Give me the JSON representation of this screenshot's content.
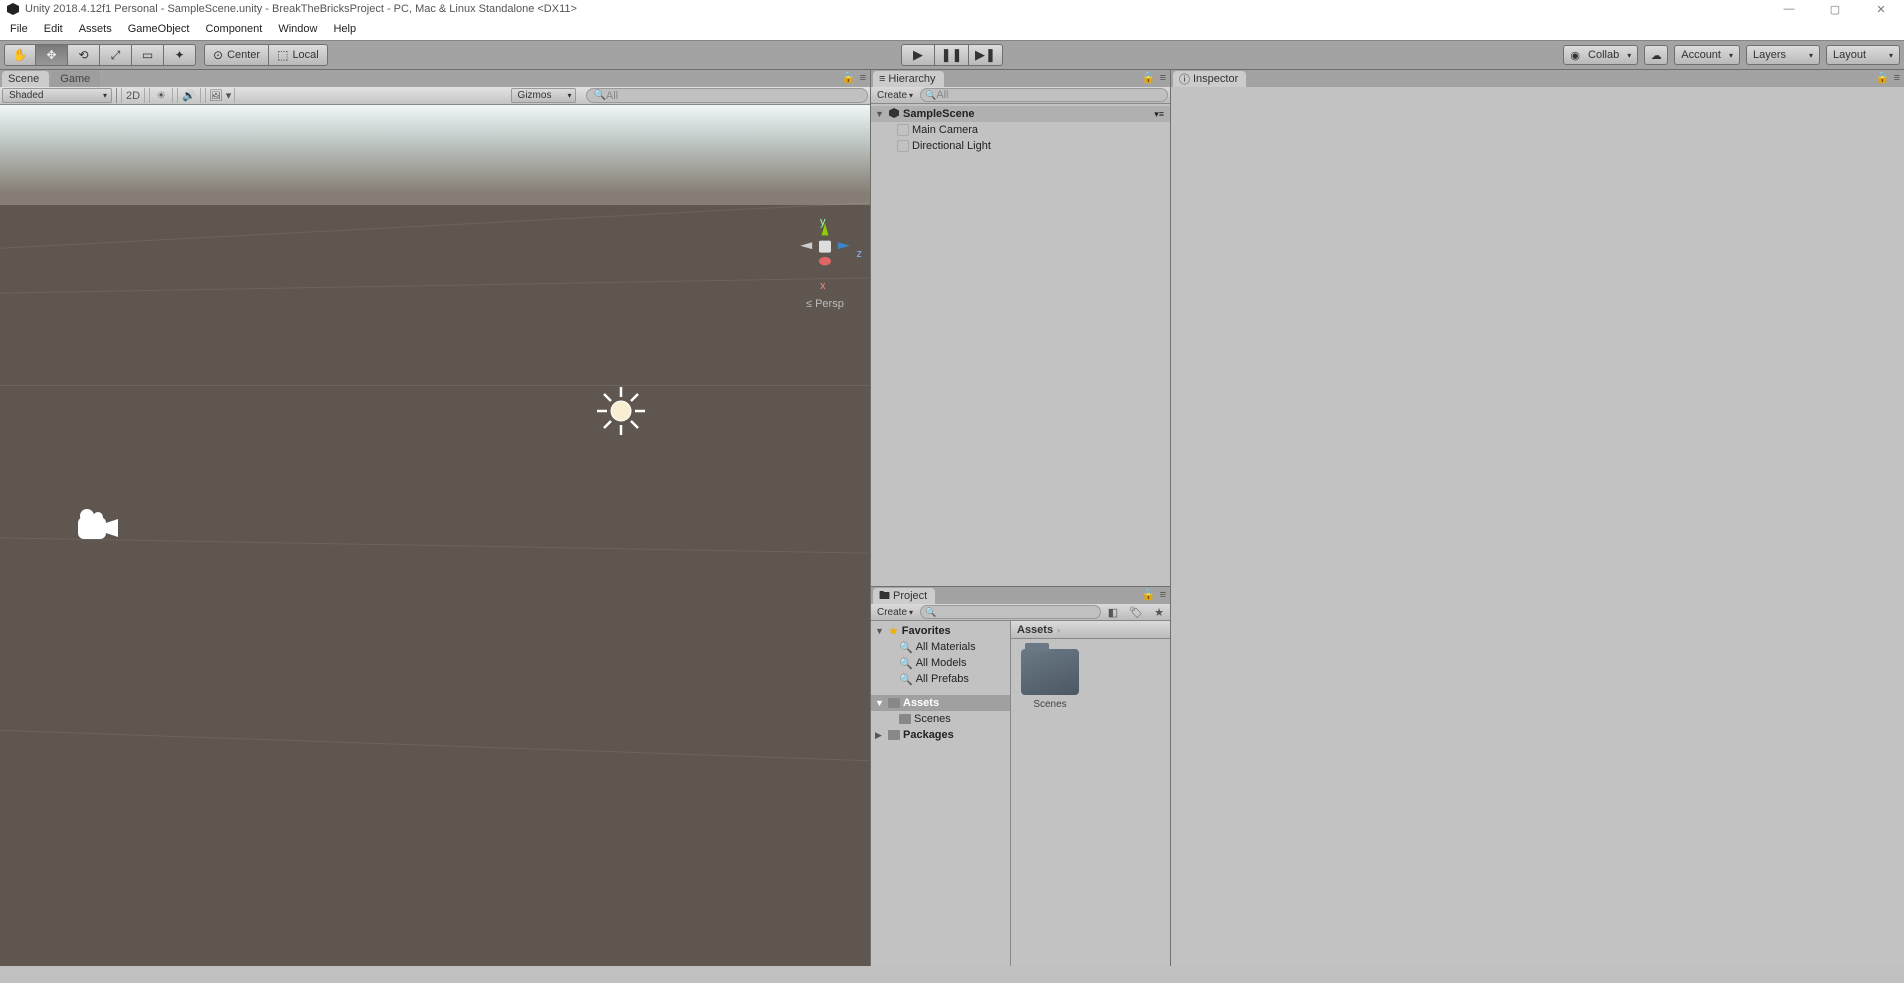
{
  "titlebar": {
    "text": "Unity 2018.4.12f1 Personal - SampleScene.unity - BreakTheBricksProject - PC, Mac & Linux Standalone <DX11>"
  },
  "menubar": [
    "File",
    "Edit",
    "Assets",
    "GameObject",
    "Component",
    "Window",
    "Help"
  ],
  "toolbar": {
    "pivot": "Center",
    "handle": "Local",
    "collab": "Collab",
    "account": "Account",
    "layers": "Layers",
    "layout": "Layout"
  },
  "scene": {
    "tab1": "Scene",
    "tab2": "Game",
    "shaded": "Shaded",
    "twoD": "2D",
    "gizmos": "Gizmos",
    "search": "All",
    "persp": "Persp",
    "axes": {
      "x": "x",
      "y": "y",
      "z": "z"
    }
  },
  "hierarchy": {
    "title": "Hierarchy",
    "create": "Create",
    "search": "All",
    "scene": "SampleScene",
    "items": [
      "Main Camera",
      "Directional Light"
    ]
  },
  "project": {
    "title": "Project",
    "create": "Create",
    "favorites": {
      "label": "Favorites",
      "items": [
        "All Materials",
        "All Models",
        "All Prefabs"
      ]
    },
    "assets": {
      "label": "Assets",
      "children": [
        "Scenes"
      ]
    },
    "packages": "Packages",
    "breadcrumb": "Assets",
    "folder": "Scenes"
  },
  "inspector": {
    "title": "Inspector"
  }
}
